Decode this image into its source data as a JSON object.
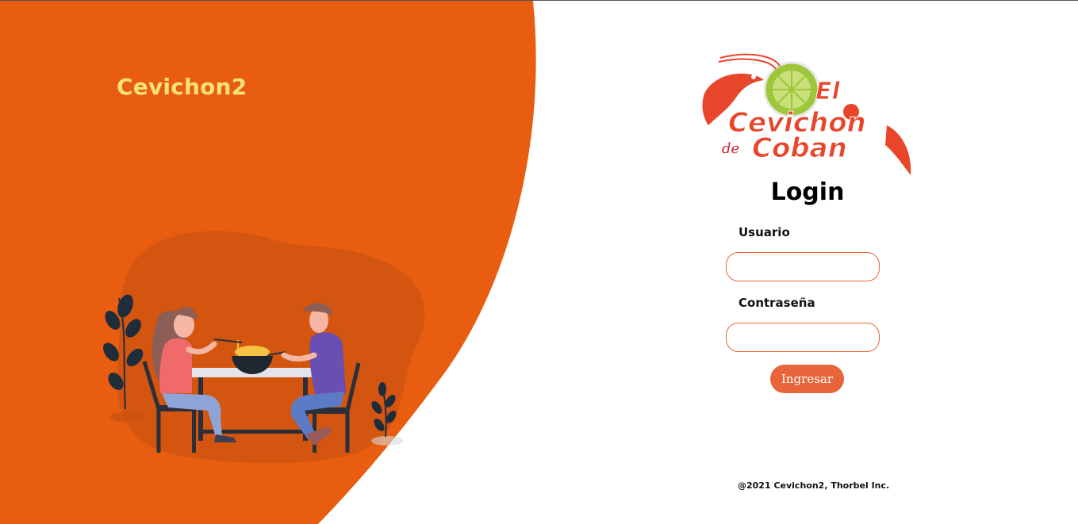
{
  "brand": {
    "name": "Cevichon2"
  },
  "logo": {
    "line1": "El",
    "line2": "Cevichon",
    "line3": "Coban",
    "small": "de"
  },
  "login": {
    "title": "Login",
    "username_label": "Usuario",
    "username_value": "",
    "password_label": "Contraseña",
    "password_value": "",
    "submit_label": "Ingresar"
  },
  "footer": {
    "text": "@2021 Cevichon2, Thorbel Inc."
  },
  "colors": {
    "accent_orange": "#e85d10",
    "button_orange": "#e8643a",
    "brand_yellow": "#f7e27a"
  }
}
